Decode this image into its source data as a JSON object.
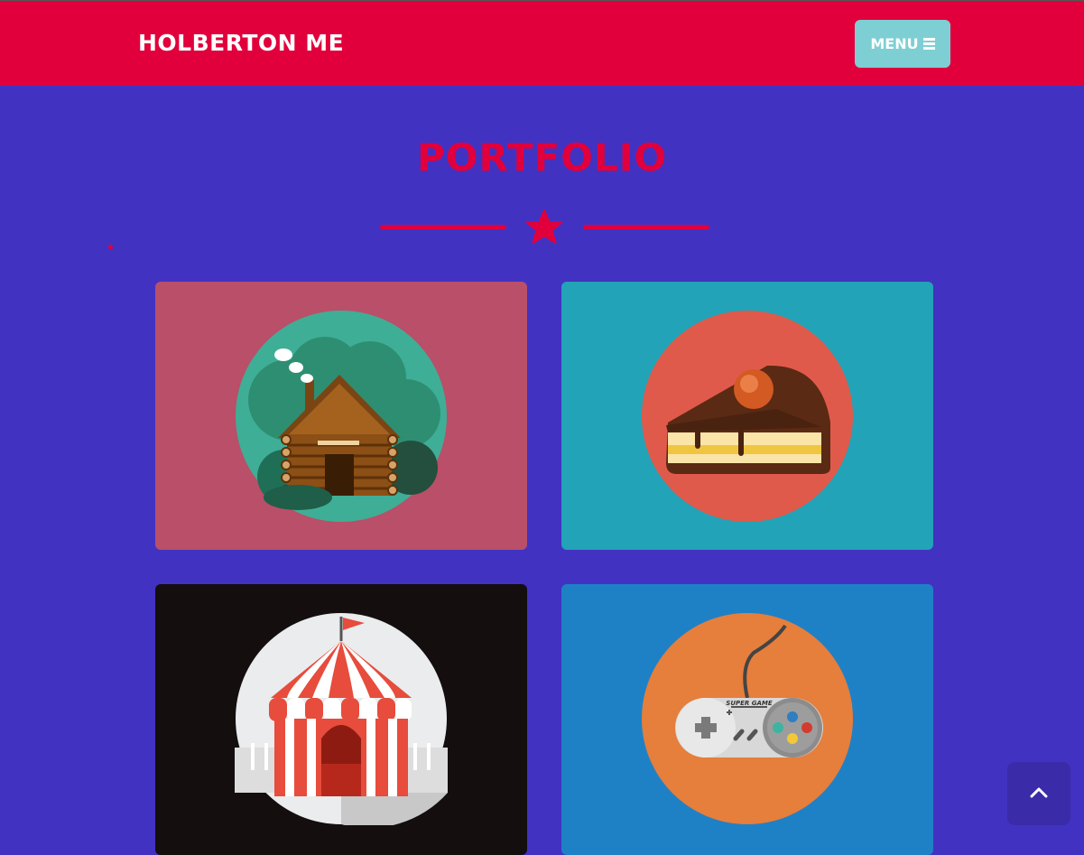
{
  "navbar": {
    "brand": "HOLBERTON ME",
    "menu_label": "MENU",
    "menu_icon": "hamburger-icon"
  },
  "section": {
    "title": "PORTFOLIO",
    "divider_icon": "star-icon"
  },
  "portfolio": {
    "items": [
      {
        "icon": "log-cabin-icon"
      },
      {
        "icon": "cake-slice-icon"
      },
      {
        "icon": "circus-tent-icon"
      },
      {
        "icon": "game-controller-icon",
        "text": "SUPER GAME"
      }
    ]
  },
  "scroll_top": {
    "icon": "chevron-up-icon"
  },
  "colors": {
    "background": "#4232c2",
    "accent": "#e1003c",
    "menu_button": "#7ecfd4"
  }
}
